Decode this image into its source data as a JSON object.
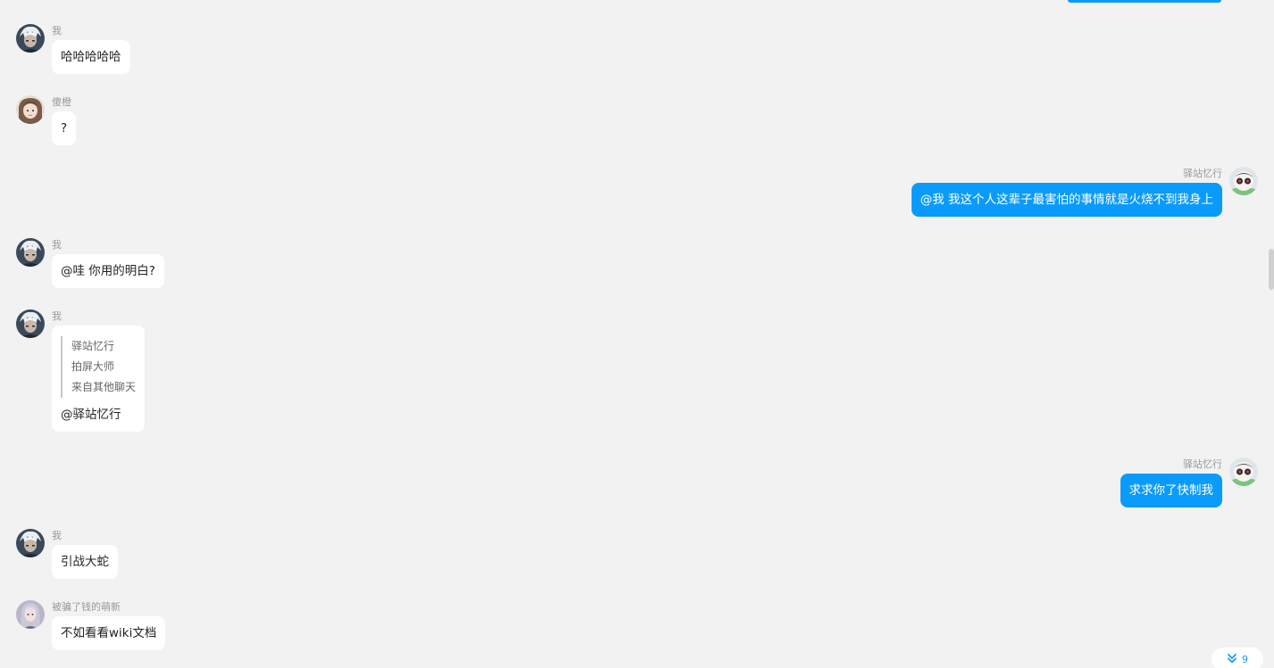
{
  "colors": {
    "background": "#f2f2f2",
    "outgoing_bubble": "#0a9bfa",
    "incoming_bubble": "#ffffff",
    "name_text": "#999999",
    "unread_accent": "#1c9bf0"
  },
  "messages": [
    {
      "side": "left",
      "avatar": "white-hair-avatar",
      "name": "我",
      "text": "哈哈哈哈哈"
    },
    {
      "side": "left",
      "avatar": "girl-avatar",
      "name": "傻橙",
      "text": "?"
    },
    {
      "side": "right",
      "avatar": "cartoon-avatar",
      "name": "驿站忆行",
      "text": "@我 我这个人这辈子最害怕的事情就是火烧不到我身上"
    },
    {
      "side": "left",
      "avatar": "white-hair-avatar",
      "name": "我",
      "text": "@哇 你用的明白?"
    },
    {
      "side": "left",
      "avatar": "white-hair-avatar",
      "name": "我",
      "quote": {
        "line1": "驿站忆行",
        "line2": "拍屏大师",
        "line3": "来自其他聊天"
      },
      "text": "@驿站忆行"
    },
    {
      "side": "right",
      "avatar": "cartoon-avatar",
      "name": "驿站忆行",
      "text": "求求你了快制我"
    },
    {
      "side": "left",
      "avatar": "white-hair-avatar",
      "name": "我",
      "text": "引战大蛇"
    },
    {
      "side": "left",
      "avatar": "anime-girl-avatar",
      "name": "被骗了钱的萌新",
      "text": "不如看看wiki文档"
    }
  ],
  "unread": {
    "icon": "double-chevron-down-icon",
    "count": "9"
  }
}
